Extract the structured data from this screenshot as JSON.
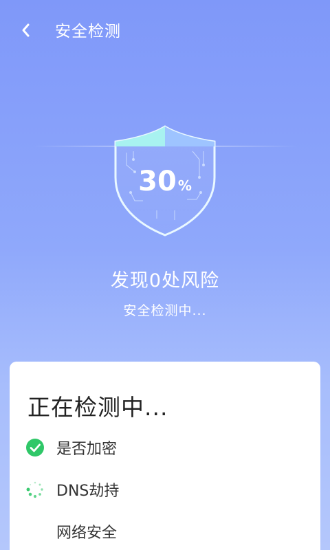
{
  "header": {
    "title": "安全检测",
    "back_icon": "chevron-left-icon"
  },
  "scan": {
    "percent": "30",
    "percent_unit": "%",
    "progress": 0.3,
    "headline": "发现0处风险",
    "status_text": "安全检测中..."
  },
  "panel": {
    "title": "正在检测中...",
    "items": [
      {
        "label": "是否加密",
        "status": "done",
        "icon": "check-circle-icon"
      },
      {
        "label": "DNS劫持",
        "status": "loading",
        "icon": "spinner-icon"
      },
      {
        "label": "网络安全",
        "status": "pending",
        "icon": ""
      }
    ]
  },
  "colors": {
    "background_top": "#7f98f9",
    "background_bottom": "#b4c7fc",
    "success_green": "#2fc768",
    "card_bg": "#ffffff"
  }
}
